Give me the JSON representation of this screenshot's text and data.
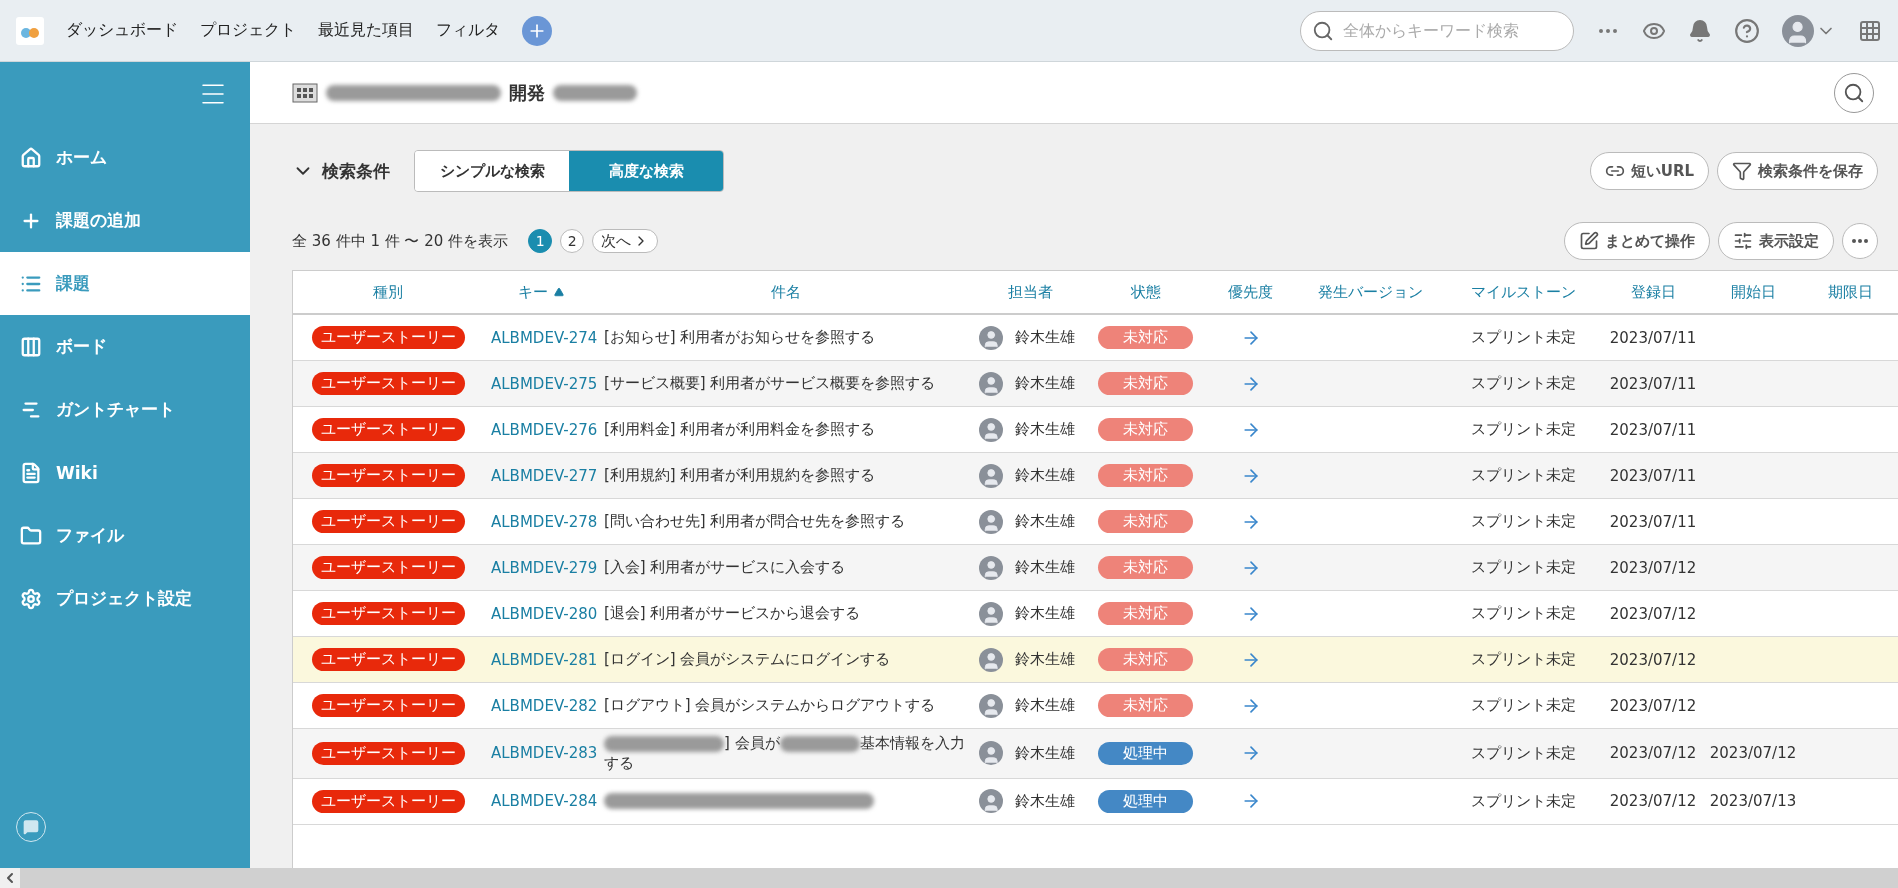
{
  "top_bar": {
    "nav": [
      "ダッシュボード",
      "プロジェクト",
      "最近見た項目",
      "フィルタ"
    ],
    "search": {
      "placeholder": "全体からキーワード検索"
    }
  },
  "sidebar": {
    "items": [
      {
        "label": "ホーム",
        "kind": "home",
        "selected": false
      },
      {
        "label": "課題の追加",
        "kind": "add",
        "selected": false
      },
      {
        "label": "課題",
        "kind": "list",
        "selected": true
      },
      {
        "label": "ボード",
        "kind": "board",
        "selected": false
      },
      {
        "label": "ガントチャート",
        "kind": "gantt",
        "selected": false
      },
      {
        "label": "Wiki",
        "kind": "wiki",
        "selected": false
      },
      {
        "label": "ファイル",
        "kind": "file",
        "selected": false
      },
      {
        "label": "プロジェクト設定",
        "kind": "settings",
        "selected": false
      }
    ]
  },
  "project": {
    "title": "開発"
  },
  "search_conditions": {
    "label": "検索条件",
    "expanded": false,
    "modes": [
      {
        "label": "シンプルな検索",
        "selected": false
      },
      {
        "label": "高度な検索",
        "selected": true
      }
    ],
    "actions": [
      {
        "label": "短いURL",
        "kind": "link"
      },
      {
        "label": "検索条件を保存",
        "kind": "filter"
      }
    ]
  },
  "results": {
    "summary": "全 36 件中 1 件 〜 20 件を表示",
    "pages": [
      {
        "label": "1",
        "selected": true
      },
      {
        "label": "2",
        "selected": false
      }
    ],
    "next": "次へ",
    "actions": [
      {
        "label": "まとめて操作",
        "kind": "edit"
      },
      {
        "label": "表示設定",
        "kind": "sliders"
      }
    ]
  },
  "table": {
    "columns": [
      {
        "label": "種別",
        "sorted": false
      },
      {
        "label": "キー",
        "sorted": true
      },
      {
        "label": "件名",
        "sorted": false
      },
      {
        "label": "担当者",
        "sorted": false
      },
      {
        "label": "状態",
        "sorted": false
      },
      {
        "label": "優先度",
        "sorted": false
      },
      {
        "label": "発生バージョン",
        "sorted": false
      },
      {
        "label": "マイルストーン",
        "sorted": false
      },
      {
        "label": "登録日",
        "sorted": false
      },
      {
        "label": "開始日",
        "sorted": false
      },
      {
        "label": "期限日",
        "sorted": false
      }
    ],
    "rows": [
      {
        "type": "ユーザーストーリー",
        "key": "ALBMDEV-274",
        "subject": "[お知らせ] 利用者がお知らせを参照する",
        "assignee": "鈴木生雄",
        "status": {
          "label": "未対応",
          "color": "#ee8379"
        },
        "milestone": "スプリント未定",
        "created": "2023/07/11",
        "highlighted": false
      },
      {
        "type": "ユーザーストーリー",
        "key": "ALBMDEV-275",
        "subject": "[サービス概要] 利用者がサービス概要を参照する",
        "assignee": "鈴木生雄",
        "status": {
          "label": "未対応",
          "color": "#ee8379"
        },
        "milestone": "スプリント未定",
        "created": "2023/07/11",
        "highlighted": false
      },
      {
        "type": "ユーザーストーリー",
        "key": "ALBMDEV-276",
        "subject": "[利用料金] 利用者が利用料金を参照する",
        "assignee": "鈴木生雄",
        "status": {
          "label": "未対応",
          "color": "#ee8379"
        },
        "milestone": "スプリント未定",
        "created": "2023/07/11",
        "highlighted": false
      },
      {
        "type": "ユーザーストーリー",
        "key": "ALBMDEV-277",
        "subject": "[利用規約] 利用者が利用規約を参照する",
        "assignee": "鈴木生雄",
        "status": {
          "label": "未対応",
          "color": "#ee8379"
        },
        "milestone": "スプリント未定",
        "created": "2023/07/11",
        "highlighted": false
      },
      {
        "type": "ユーザーストーリー",
        "key": "ALBMDEV-278",
        "subject": "[問い合わせ先] 利用者が問合せ先を参照する",
        "assignee": "鈴木生雄",
        "status": {
          "label": "未対応",
          "color": "#ee8379"
        },
        "milestone": "スプリント未定",
        "created": "2023/07/11",
        "highlighted": false
      },
      {
        "type": "ユーザーストーリー",
        "key": "ALBMDEV-279",
        "subject": "[入会] 利用者がサービスに入会する",
        "assignee": "鈴木生雄",
        "status": {
          "label": "未対応",
          "color": "#ee8379"
        },
        "milestone": "スプリント未定",
        "created": "2023/07/12",
        "highlighted": false
      },
      {
        "type": "ユーザーストーリー",
        "key": "ALBMDEV-280",
        "subject": "[退会] 利用者がサービスから退会する",
        "assignee": "鈴木生雄",
        "status": {
          "label": "未対応",
          "color": "#ee8379"
        },
        "milestone": "スプリント未定",
        "created": "2023/07/12",
        "highlighted": false
      },
      {
        "type": "ユーザーストーリー",
        "key": "ALBMDEV-281",
        "subject": "[ログイン] 会員がシステムにログインする",
        "assignee": "鈴木生雄",
        "status": {
          "label": "未対応",
          "color": "#ee8379"
        },
        "milestone": "スプリント未定",
        "created": "2023/07/12",
        "highlighted": true
      },
      {
        "type": "ユーザーストーリー",
        "key": "ALBMDEV-282",
        "subject": "[ログアウト] 会員がシステムからログアウトする",
        "assignee": "鈴木生雄",
        "status": {
          "label": "未対応",
          "color": "#ee8379"
        },
        "milestone": "スプリント未定",
        "created": "2023/07/12",
        "highlighted": false
      },
      {
        "type": "ユーザーストーリー",
        "key": "ALBMDEV-283",
        "subject_parts": [
          {
            "kind": "redacted"
          },
          {
            "kind": "text",
            "text": "] 会員が"
          },
          {
            "kind": "redacted"
          },
          {
            "kind": "text",
            "text": "基本情報を入力する"
          }
        ],
        "assignee": "鈴木生雄",
        "status": {
          "label": "処理中",
          "color": "#4488c5"
        },
        "milestone": "スプリント未定",
        "created": "2023/07/12",
        "start": "2023/07/12",
        "highlighted": false
      },
      {
        "type": "ユーザーストーリー",
        "key": "ALBMDEV-284",
        "subject_parts": [
          {
            "kind": "redacted"
          }
        ],
        "assignee": "鈴木生雄",
        "status": {
          "label": "処理中",
          "color": "#4488c5"
        },
        "milestone": "スプリント未定",
        "created": "2023/07/12",
        "start": "2023/07/13",
        "highlighted": false
      }
    ]
  }
}
